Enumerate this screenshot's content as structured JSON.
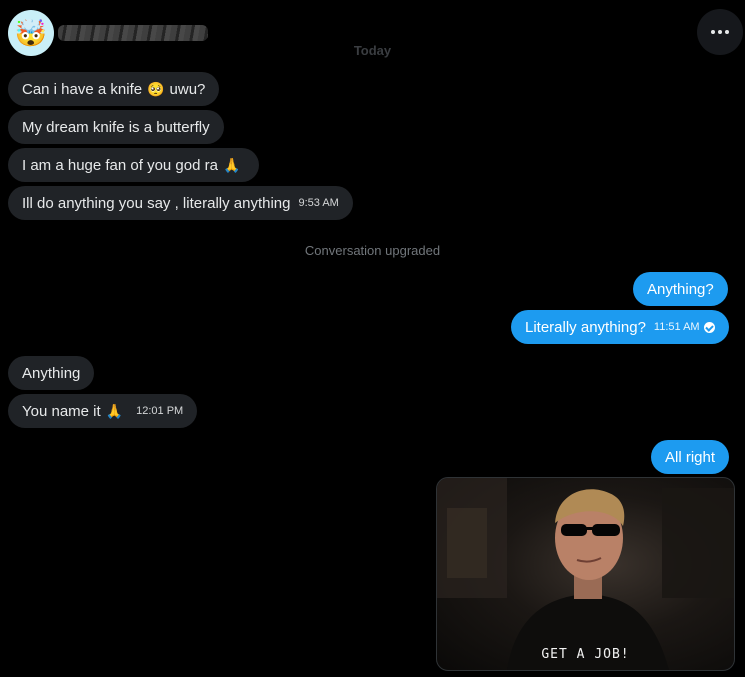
{
  "header": {
    "avatar_emoji": "🤯",
    "more_icon": "more-horizontal-icon"
  },
  "conversation": {
    "day_label": "Today",
    "system_message": "Conversation upgraded"
  },
  "messages": [
    {
      "side": "in",
      "text_before": "Can i have a knife",
      "emoji": "🥺",
      "text_after": "uwu?",
      "time": ""
    },
    {
      "side": "in",
      "text": "My dream knife is a butterfly",
      "time": ""
    },
    {
      "side": "in",
      "text": "I am a huge fan of you god ra",
      "emoji": "🙏",
      "time": ""
    },
    {
      "side": "in",
      "text": "Ill do anything you say , literally anything",
      "time": "9:53 AM"
    },
    {
      "side": "out",
      "text": "Anything?",
      "time": ""
    },
    {
      "side": "out",
      "text": "Literally anything?",
      "time": "11:51 AM",
      "seen": true
    },
    {
      "side": "in",
      "text": "Anything",
      "time": ""
    },
    {
      "side": "in",
      "text": "You name it",
      "emoji": "🙏",
      "time": "12:01 PM"
    },
    {
      "side": "out",
      "text": "All right",
      "time": ""
    }
  ],
  "gif": {
    "caption": "GET A JOB!"
  },
  "colors": {
    "outgoing_bubble": "#1d9bf0",
    "incoming_bubble": "#202327",
    "background": "#000000"
  }
}
